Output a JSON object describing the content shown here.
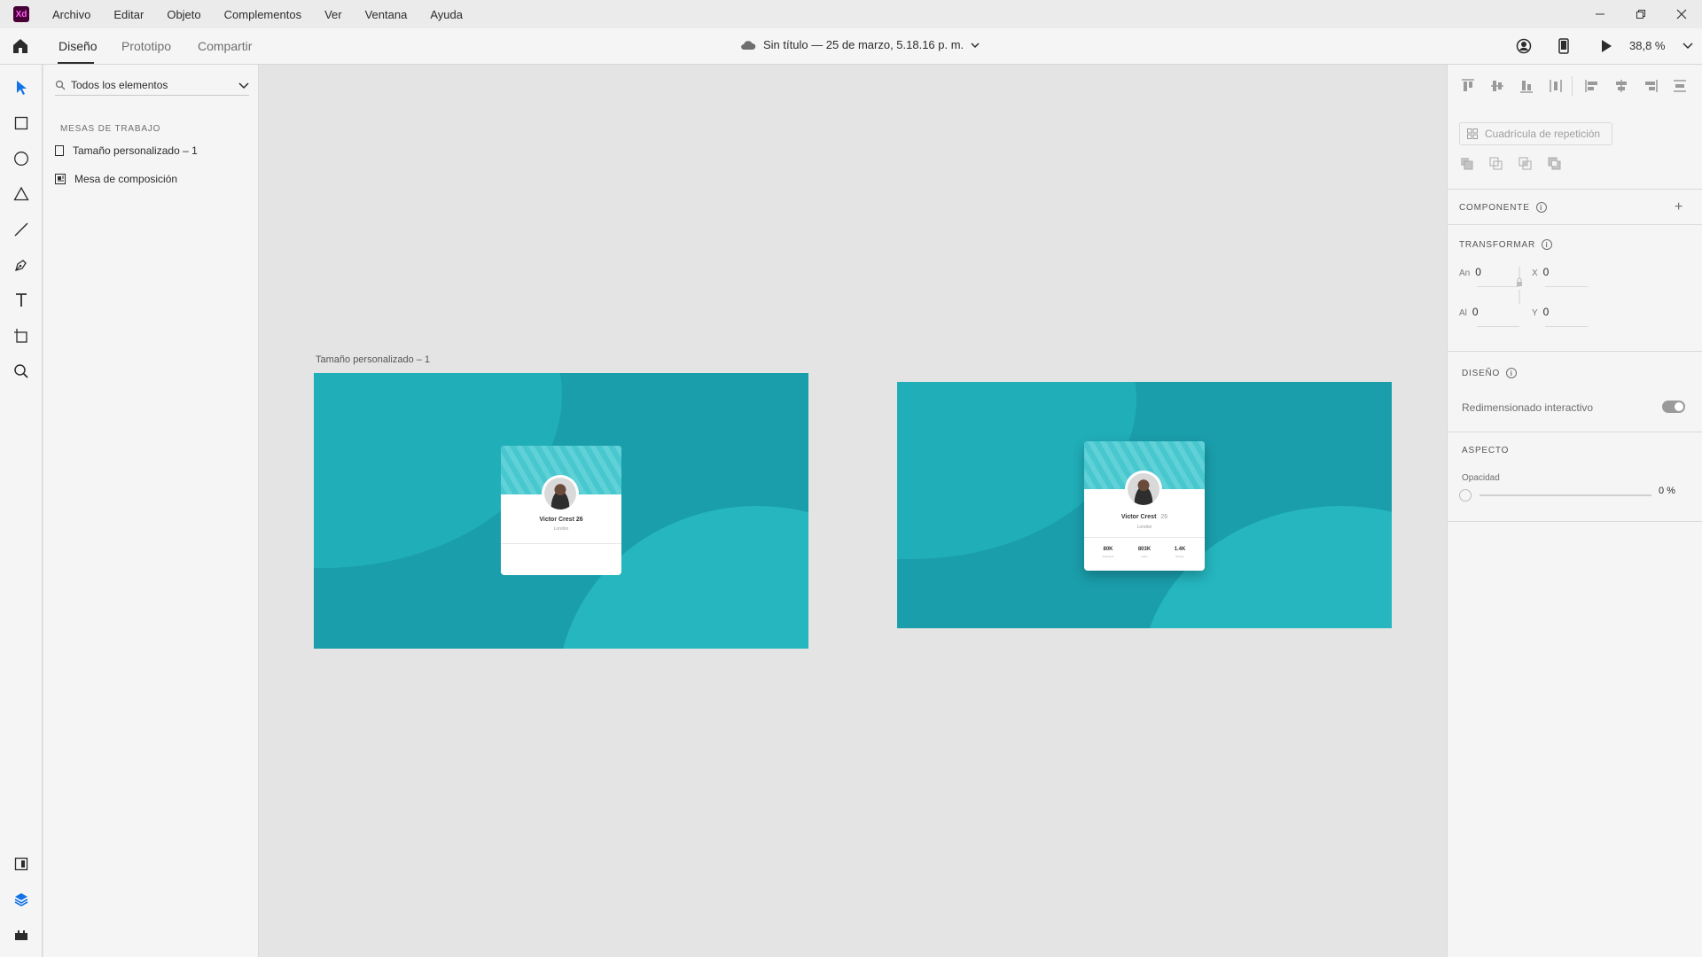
{
  "app": {
    "logo": "Xd",
    "menus": [
      "Archivo",
      "Editar",
      "Objeto",
      "Complementos",
      "Ver",
      "Ventana",
      "Ayuda"
    ],
    "window_controls": [
      "minimize-icon",
      "restore-icon",
      "close-icon"
    ]
  },
  "toolbar": {
    "tabs": [
      "Diseño",
      "Prototipo",
      "Compartir"
    ],
    "active_tab": "Diseño",
    "doc_title": "Sin título — 25 de marzo, 5.18.16 p. m.",
    "zoom": "38,8 %"
  },
  "tools": [
    "select-tool-icon",
    "rectangle-tool-icon",
    "ellipse-tool-icon",
    "polygon-tool-icon",
    "line-tool-icon",
    "pen-tool-icon",
    "text-tool-icon",
    "artboard-tool-icon",
    "zoom-tool-icon",
    "assets-icon",
    "layers-icon",
    "plugins-icon"
  ],
  "layers": {
    "filter": "Todos los elementos",
    "section": "MESAS DE TRABAJO",
    "items": [
      "Tamaño personalizado – 1",
      "Mesa de composición"
    ]
  },
  "canvas": {
    "artboard1_label": "Tamaño personalizado – 1",
    "card1": {
      "name": "Victor Crest 26",
      "city": "London"
    },
    "card2": {
      "name": "Victor Crest",
      "age": "26",
      "city": "London",
      "stats": [
        {
          "value": "80K",
          "label": "Followers"
        },
        {
          "value": "803K",
          "label": "Likes"
        },
        {
          "value": "1.4K",
          "label": "Photos"
        }
      ]
    }
  },
  "props": {
    "repeat_grid": "Cuadrícula de repetición",
    "component": "COMPONENTE",
    "transform": "TRANSFORMAR",
    "width_label": "An",
    "width": "0",
    "height_label": "Al",
    "height": "0",
    "x_label": "X",
    "x": "0",
    "y_label": "Y",
    "y": "0",
    "layout": "DISEÑO",
    "responsive_resize": "Redimensionado interactivo",
    "responsive_on": true,
    "appearance": "ASPECTO",
    "opacity_label": "Opacidad",
    "opacity": "0 %"
  },
  "colors": {
    "artboard": "#1a9eab",
    "accent": "#1473e6",
    "brand": "#470137"
  }
}
